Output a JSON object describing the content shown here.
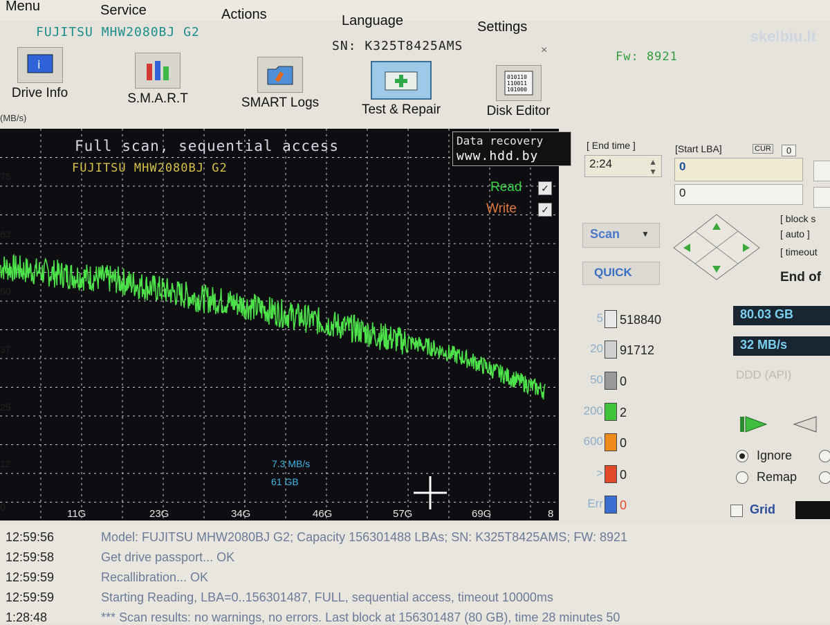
{
  "menu": [
    "Menu",
    "Service",
    "Actions",
    "Language",
    "Settings"
  ],
  "watermark": "skelbiu.lt",
  "drive": {
    "model": "FUJITSU MHW2080BJ G2",
    "sn": "SN: K325T8425AMS",
    "close": "×",
    "fw": "Fw: 8921"
  },
  "toolbar": [
    {
      "label": "Drive Info",
      "icon": "drive-info-icon"
    },
    {
      "label": "S.M.A.R.T",
      "icon": "smart-icon"
    },
    {
      "label": "SMART Logs",
      "icon": "smart-logs-icon"
    },
    {
      "label": "Test & Repair",
      "icon": "test-repair-icon"
    },
    {
      "label": "Disk Editor",
      "icon": "disk-editor-icon"
    }
  ],
  "graph": {
    "unit": "(MB/s)",
    "title": "Full scan, sequential access",
    "subtitle": "FUJITSU MHW2080BJ G2",
    "ad_line1": "Data recovery",
    "ad_line2": "www.hdd.by",
    "read_label": "Read",
    "write_label": "Write",
    "cursor_speed": "7.3 MB/s",
    "cursor_pos": "61 GB"
  },
  "chart_data": {
    "type": "line",
    "ylabel": "(MB/s)",
    "y_ticks": [
      "75",
      "63",
      "50",
      "37",
      "25",
      "12",
      "0"
    ],
    "x_ticks": [
      "11G",
      "23G",
      "34G",
      "46G",
      "57G",
      "69G",
      "8"
    ],
    "ylim": [
      0,
      88
    ],
    "xlim": [
      0,
      82
    ],
    "grid": true,
    "series": [
      {
        "name": "Read",
        "x": [
          0,
          5,
          11,
          17,
          23,
          29,
          34,
          40,
          46,
          52,
          57,
          63,
          69,
          75,
          80
        ],
        "y": [
          57,
          56,
          55,
          54,
          52,
          50,
          49,
          47,
          45,
          43,
          41,
          39,
          36,
          32,
          29
        ]
      }
    ]
  },
  "controls": {
    "end_time_label": "[ End time ]",
    "end_time_value": "2:24",
    "start_lba_label": "[Start LBA]",
    "cur_label": "CUR",
    "cur_value": "0",
    "start_lba_value": "0",
    "lba_value2": "0",
    "block_label": "[ block s",
    "auto_label": "[ auto ]",
    "timeout_label": "[ timeout",
    "scan_label": "Scan",
    "quick_label": "QUICK",
    "end_of_label": "End of"
  },
  "blocks": [
    {
      "ms": "5",
      "count": "518840",
      "color": "#e8e8e8"
    },
    {
      "ms": "20",
      "count": "91712",
      "color": "#cfcfcf"
    },
    {
      "ms": "50",
      "count": "0",
      "color": "#9a9a9a"
    },
    {
      "ms": "200",
      "count": "2",
      "color": "#3fc43a"
    },
    {
      "ms": "600",
      "count": "0",
      "color": "#f08a1a"
    },
    {
      "ms": ">",
      "count": "0",
      "color": "#e04a2a"
    },
    {
      "ms": "Err",
      "count": "0",
      "color": "#3a6ed0"
    }
  ],
  "stats": {
    "capacity": "80.03 GB",
    "speed": "32 MB/s",
    "ddd": "DDD (API)"
  },
  "options": {
    "ignore": "Ignore",
    "remap": "Remap",
    "grid": "Grid"
  },
  "log": [
    {
      "time": "12:59:56",
      "msg": "Model: FUJITSU MHW2080BJ G2; Capacity 156301488 LBAs; SN: K325T8425AMS; FW: 8921"
    },
    {
      "time": "12:59:58",
      "msg": "Get drive passport... OK"
    },
    {
      "time": "12:59:59",
      "msg": "Recallibration... OK"
    },
    {
      "time": "12:59:59",
      "msg": "Starting Reading, LBA=0..156301487, FULL, sequential access, timeout 10000ms"
    },
    {
      "time": "1:28:48",
      "msg": "*** Scan results: no warnings, no errors. Last block at 156301487 (80 GB), time 28 minutes 50"
    }
  ]
}
